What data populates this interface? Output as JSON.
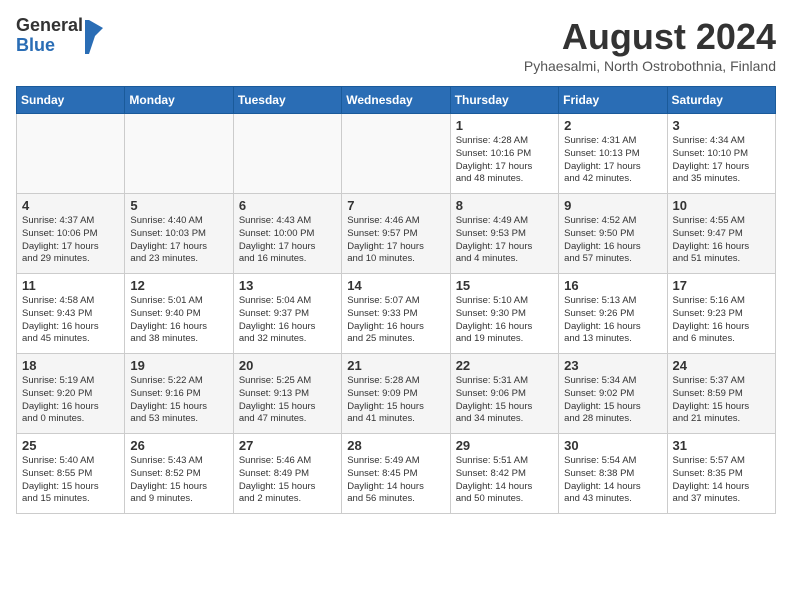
{
  "header": {
    "logo_line1": "General",
    "logo_line2": "Blue",
    "month_title": "August 2024",
    "location": "Pyhaesalmi, North Ostrobothnia, Finland"
  },
  "days_of_week": [
    "Sunday",
    "Monday",
    "Tuesday",
    "Wednesday",
    "Thursday",
    "Friday",
    "Saturday"
  ],
  "weeks": [
    [
      {
        "day": "",
        "info": ""
      },
      {
        "day": "",
        "info": ""
      },
      {
        "day": "",
        "info": ""
      },
      {
        "day": "",
        "info": ""
      },
      {
        "day": "1",
        "info": "Sunrise: 4:28 AM\nSunset: 10:16 PM\nDaylight: 17 hours\nand 48 minutes."
      },
      {
        "day": "2",
        "info": "Sunrise: 4:31 AM\nSunset: 10:13 PM\nDaylight: 17 hours\nand 42 minutes."
      },
      {
        "day": "3",
        "info": "Sunrise: 4:34 AM\nSunset: 10:10 PM\nDaylight: 17 hours\nand 35 minutes."
      }
    ],
    [
      {
        "day": "4",
        "info": "Sunrise: 4:37 AM\nSunset: 10:06 PM\nDaylight: 17 hours\nand 29 minutes."
      },
      {
        "day": "5",
        "info": "Sunrise: 4:40 AM\nSunset: 10:03 PM\nDaylight: 17 hours\nand 23 minutes."
      },
      {
        "day": "6",
        "info": "Sunrise: 4:43 AM\nSunset: 10:00 PM\nDaylight: 17 hours\nand 16 minutes."
      },
      {
        "day": "7",
        "info": "Sunrise: 4:46 AM\nSunset: 9:57 PM\nDaylight: 17 hours\nand 10 minutes."
      },
      {
        "day": "8",
        "info": "Sunrise: 4:49 AM\nSunset: 9:53 PM\nDaylight: 17 hours\nand 4 minutes."
      },
      {
        "day": "9",
        "info": "Sunrise: 4:52 AM\nSunset: 9:50 PM\nDaylight: 16 hours\nand 57 minutes."
      },
      {
        "day": "10",
        "info": "Sunrise: 4:55 AM\nSunset: 9:47 PM\nDaylight: 16 hours\nand 51 minutes."
      }
    ],
    [
      {
        "day": "11",
        "info": "Sunrise: 4:58 AM\nSunset: 9:43 PM\nDaylight: 16 hours\nand 45 minutes."
      },
      {
        "day": "12",
        "info": "Sunrise: 5:01 AM\nSunset: 9:40 PM\nDaylight: 16 hours\nand 38 minutes."
      },
      {
        "day": "13",
        "info": "Sunrise: 5:04 AM\nSunset: 9:37 PM\nDaylight: 16 hours\nand 32 minutes."
      },
      {
        "day": "14",
        "info": "Sunrise: 5:07 AM\nSunset: 9:33 PM\nDaylight: 16 hours\nand 25 minutes."
      },
      {
        "day": "15",
        "info": "Sunrise: 5:10 AM\nSunset: 9:30 PM\nDaylight: 16 hours\nand 19 minutes."
      },
      {
        "day": "16",
        "info": "Sunrise: 5:13 AM\nSunset: 9:26 PM\nDaylight: 16 hours\nand 13 minutes."
      },
      {
        "day": "17",
        "info": "Sunrise: 5:16 AM\nSunset: 9:23 PM\nDaylight: 16 hours\nand 6 minutes."
      }
    ],
    [
      {
        "day": "18",
        "info": "Sunrise: 5:19 AM\nSunset: 9:20 PM\nDaylight: 16 hours\nand 0 minutes."
      },
      {
        "day": "19",
        "info": "Sunrise: 5:22 AM\nSunset: 9:16 PM\nDaylight: 15 hours\nand 53 minutes."
      },
      {
        "day": "20",
        "info": "Sunrise: 5:25 AM\nSunset: 9:13 PM\nDaylight: 15 hours\nand 47 minutes."
      },
      {
        "day": "21",
        "info": "Sunrise: 5:28 AM\nSunset: 9:09 PM\nDaylight: 15 hours\nand 41 minutes."
      },
      {
        "day": "22",
        "info": "Sunrise: 5:31 AM\nSunset: 9:06 PM\nDaylight: 15 hours\nand 34 minutes."
      },
      {
        "day": "23",
        "info": "Sunrise: 5:34 AM\nSunset: 9:02 PM\nDaylight: 15 hours\nand 28 minutes."
      },
      {
        "day": "24",
        "info": "Sunrise: 5:37 AM\nSunset: 8:59 PM\nDaylight: 15 hours\nand 21 minutes."
      }
    ],
    [
      {
        "day": "25",
        "info": "Sunrise: 5:40 AM\nSunset: 8:55 PM\nDaylight: 15 hours\nand 15 minutes."
      },
      {
        "day": "26",
        "info": "Sunrise: 5:43 AM\nSunset: 8:52 PM\nDaylight: 15 hours\nand 9 minutes."
      },
      {
        "day": "27",
        "info": "Sunrise: 5:46 AM\nSunset: 8:49 PM\nDaylight: 15 hours\nand 2 minutes."
      },
      {
        "day": "28",
        "info": "Sunrise: 5:49 AM\nSunset: 8:45 PM\nDaylight: 14 hours\nand 56 minutes."
      },
      {
        "day": "29",
        "info": "Sunrise: 5:51 AM\nSunset: 8:42 PM\nDaylight: 14 hours\nand 50 minutes."
      },
      {
        "day": "30",
        "info": "Sunrise: 5:54 AM\nSunset: 8:38 PM\nDaylight: 14 hours\nand 43 minutes."
      },
      {
        "day": "31",
        "info": "Sunrise: 5:57 AM\nSunset: 8:35 PM\nDaylight: 14 hours\nand 37 minutes."
      }
    ]
  ]
}
